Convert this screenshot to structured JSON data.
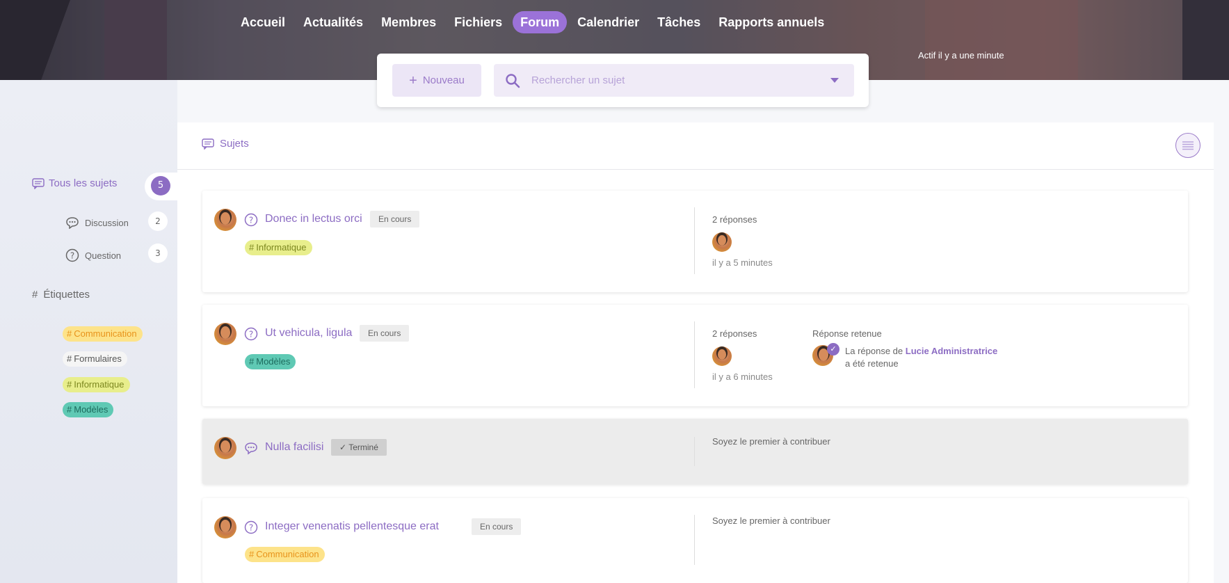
{
  "nav": {
    "items": [
      "Accueil",
      "Actualités",
      "Membres",
      "Fichiers",
      "Forum",
      "Calendrier",
      "Tâches",
      "Rapports annuels"
    ],
    "active": "Forum"
  },
  "activity": "Actif il y a une minute",
  "toolbar": {
    "new_label": "Nouveau",
    "search_placeholder": "Rechercher un sujet"
  },
  "sidebar": {
    "all_label": "Tous les sujets",
    "all_count": "5",
    "types": [
      {
        "label": "Discussion",
        "count": "2"
      },
      {
        "label": "Question",
        "count": "3"
      }
    ],
    "tags_title": "Étiquettes",
    "tags": [
      "Communication",
      "Formulaires",
      "Informatique",
      "Modèles"
    ]
  },
  "main": {
    "title": "Sujets"
  },
  "topics": [
    {
      "title": "Donec in lectus orci",
      "status": "En cours",
      "tag": "Informatique",
      "replies": "2 réponses",
      "time": "il y a 5 minutes"
    },
    {
      "title": "Ut vehicula, ligula",
      "status": "En cours",
      "tag": "Modèles",
      "replies": "2 réponses",
      "time": "il y a 6 minutes",
      "accepted_title": "Réponse retenue",
      "accepted_prefix": "La réponse de",
      "accepted_author": "Lucie Administratrice",
      "accepted_suffix": "a été retenue"
    },
    {
      "title": "Nulla facilisi",
      "status": "Terminé",
      "empty": "Soyez le premier à contribuer"
    },
    {
      "title": "Integer venenatis pellentesque erat",
      "status": "En cours",
      "tag": "Communication",
      "empty": "Soyez le premier à contribuer"
    }
  ],
  "colors": {
    "accent": "#8c6cc3",
    "nav_active": "#9b72d8",
    "tag_communication": "#fde38a",
    "tag_informatique": "#e8ee8c",
    "tag_modeles": "#5fc9b4"
  }
}
